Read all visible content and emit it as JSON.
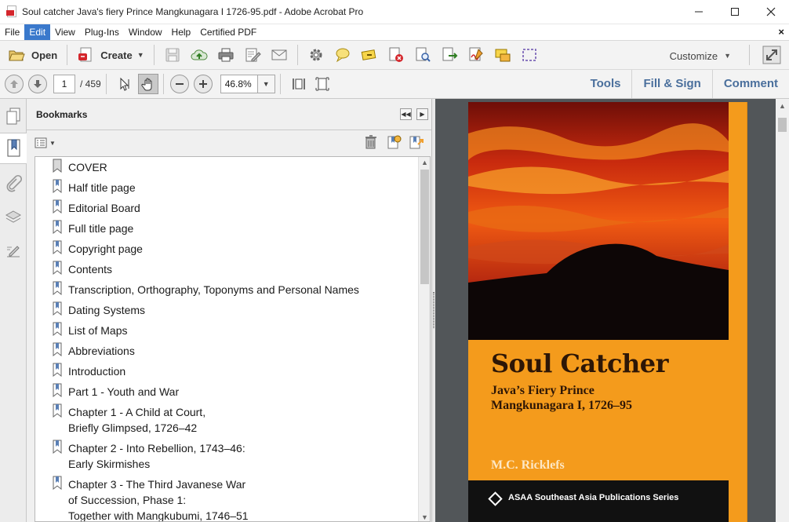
{
  "window": {
    "title": "Soul catcher Java's fiery Prince Mangkunagara I 1726-95.pdf - Adobe Acrobat Pro",
    "minimize": "—",
    "maximize": "☐",
    "close": "✕"
  },
  "menu": {
    "items": [
      "File",
      "Edit",
      "View",
      "Plug-Ins",
      "Window",
      "Help",
      "Certified PDF"
    ],
    "active_index": 1,
    "close_document": "×"
  },
  "toolbar": {
    "open_label": "Open",
    "create_label": "Create",
    "customize_label": "Customize"
  },
  "nav": {
    "current_page": "1",
    "page_count": "/ 459",
    "zoom": "46.8%"
  },
  "panels": {
    "tools": "Tools",
    "fill_sign": "Fill & Sign",
    "comment": "Comment"
  },
  "bookmarks": {
    "title": "Bookmarks",
    "items": [
      {
        "line1": "COVER",
        "line2": "",
        "line3": ""
      },
      {
        "line1": "Half title page",
        "line2": "",
        "line3": ""
      },
      {
        "line1": "Editorial Board",
        "line2": "",
        "line3": ""
      },
      {
        "line1": "Full title page",
        "line2": "",
        "line3": ""
      },
      {
        "line1": "Copyright page",
        "line2": "",
        "line3": ""
      },
      {
        "line1": "Contents",
        "line2": "",
        "line3": ""
      },
      {
        "line1": "Transcription, Orthography, Toponyms and Personal Names",
        "line2": "",
        "line3": ""
      },
      {
        "line1": "Dating Systems",
        "line2": "",
        "line3": ""
      },
      {
        "line1": "List of Maps",
        "line2": "",
        "line3": ""
      },
      {
        "line1": "Abbreviations",
        "line2": "",
        "line3": ""
      },
      {
        "line1": "Introduction",
        "line2": "",
        "line3": ""
      },
      {
        "line1": "Part 1 - Youth and War",
        "line2": "",
        "line3": ""
      },
      {
        "line1": "Chapter 1 - A Child at Court,",
        "line2": "Briefly Glimpsed, 1726–42",
        "line3": ""
      },
      {
        "line1": "Chapter 2 - Into Rebellion, 1743–46:",
        "line2": "Early Skirmishes",
        "line3": ""
      },
      {
        "line1": "Chapter 3 - The Third Javanese War",
        "line2": "of Succession, Phase 1:",
        "line3": "Together with Mangkubumi, 1746–51"
      }
    ]
  },
  "cover": {
    "title": "Soul Catcher",
    "subtitle_line1": "Java’s Fiery Prince",
    "subtitle_line2": "Mangkunagara I, 1726–95",
    "author": "M.C. Ricklefs",
    "series": "ASAA Southeast Asia Publications Series"
  },
  "colors": {
    "accent_blue": "#3a79cc",
    "panel_link": "#4a6f9c",
    "cover_orange": "#f49b1c",
    "cover_dark_text": "#2d1606"
  }
}
